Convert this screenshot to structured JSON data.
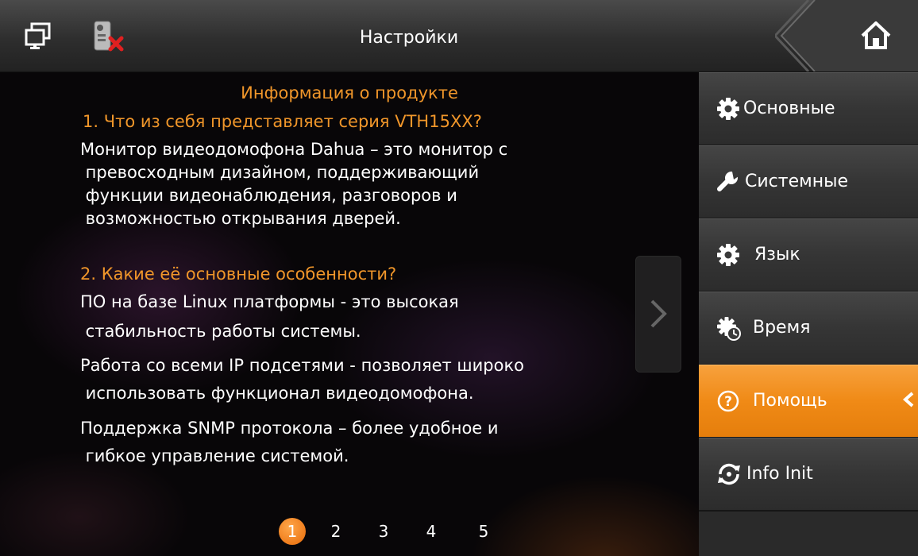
{
  "header": {
    "title": "Настройки",
    "icons": [
      "monitor-icon",
      "door-disconnected-icon",
      "home-icon"
    ]
  },
  "main": {
    "heading": "Информация о продукте",
    "q1": "1. Что из себя представляет серия VTH15XX?",
    "a1_lines": [
      "Монитор видеодомофона Dahua – это монитор с",
      " превосходным дизайном, поддерживающий",
      " функции видеонаблюдения, разговоров и",
      " возможностью открывания дверей."
    ],
    "q2": "2. Какие её основные особенности?",
    "a2_lines": [
      "ПО на базе Linux платформы - это высокая",
      " стабильность работы системы.",
      "Работа со всеми IP подсетями - позволяет широко",
      " использовать функционал видеодомофона.",
      "Поддержка SNMP протокола – более удобное и",
      " гибкое управление системой."
    ]
  },
  "pager": {
    "current": "1",
    "pages": [
      "2",
      "3",
      "4",
      "5"
    ]
  },
  "sidebar": {
    "items": [
      {
        "label": "Основные",
        "icon": "gear-icon"
      },
      {
        "label": "Системные",
        "icon": "wrench-icon"
      },
      {
        "label": "Язык",
        "icon": "gear-icon"
      },
      {
        "label": "Время",
        "icon": "gear-clock-icon"
      },
      {
        "label": "Помощь",
        "icon": "help-icon",
        "active": true
      },
      {
        "label": "Info Init",
        "icon": "refresh-icon"
      }
    ]
  },
  "colors": {
    "accent": "#f08a16",
    "heading": "#f0962a",
    "text": "#ffffff"
  }
}
